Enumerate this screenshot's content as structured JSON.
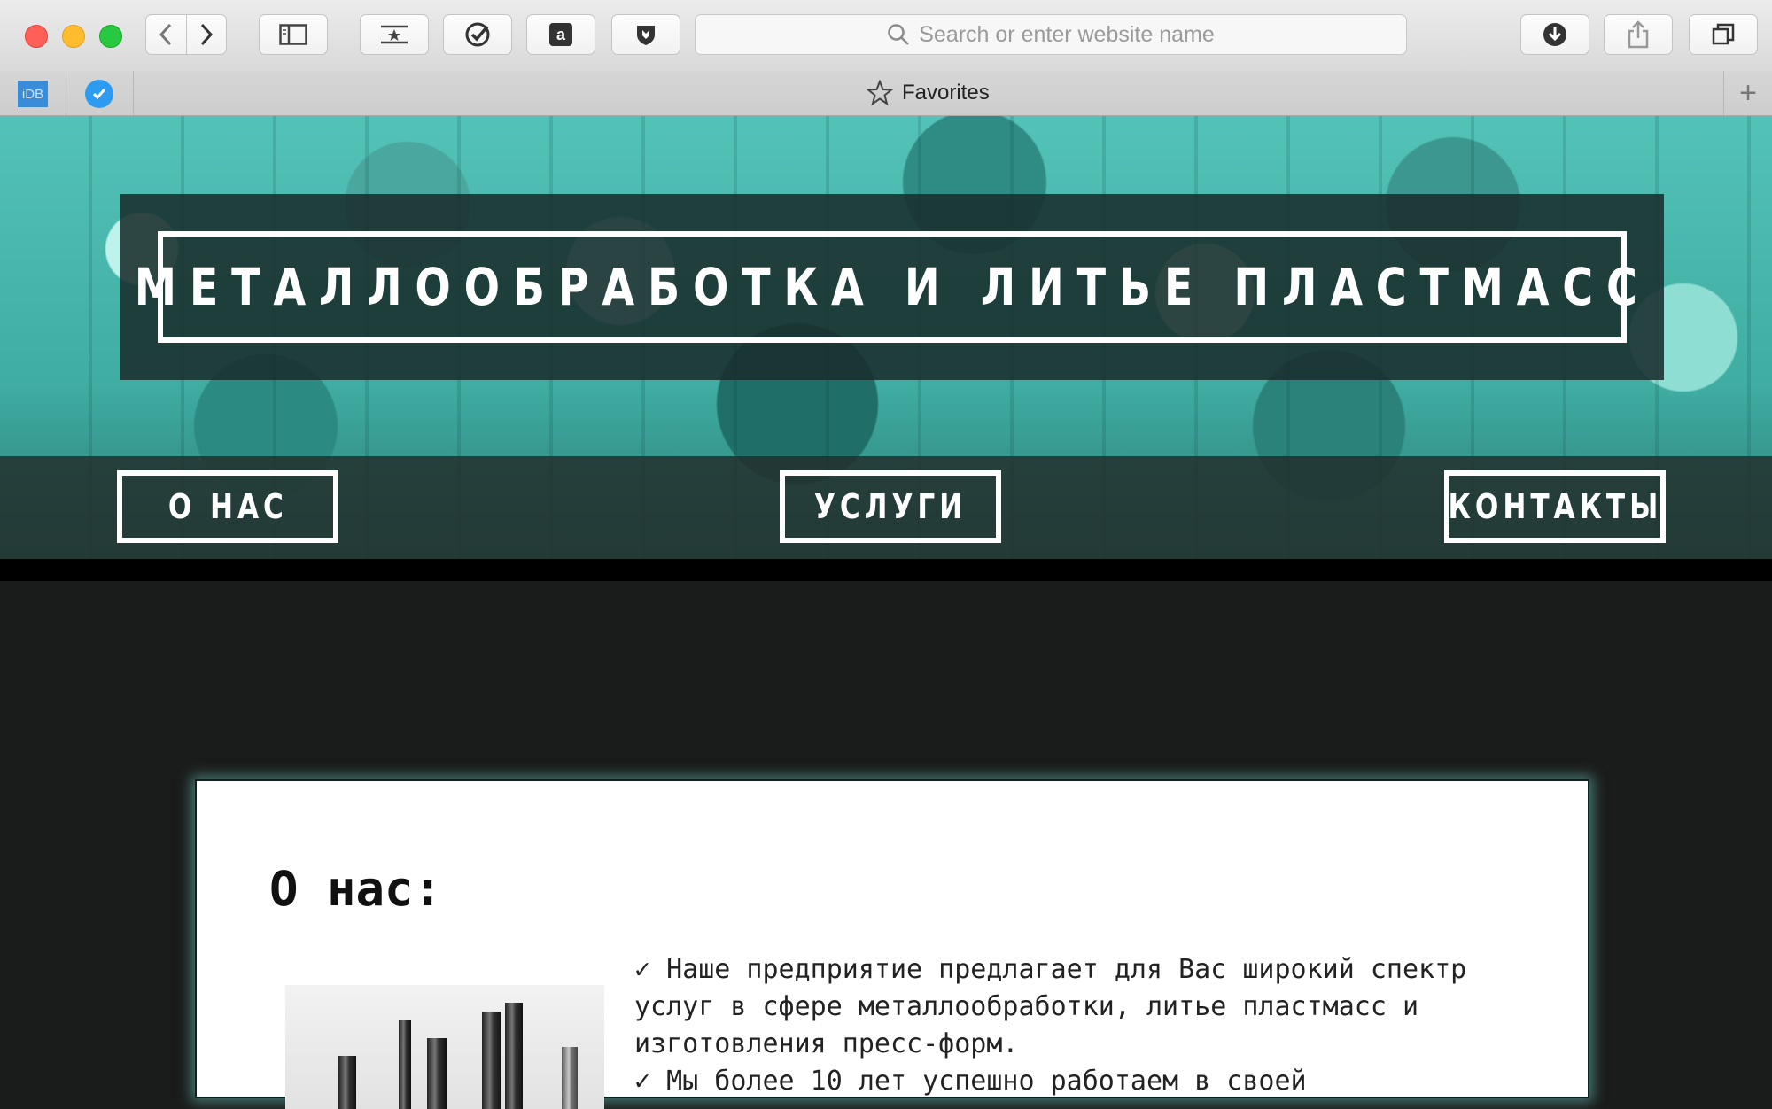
{
  "browser": {
    "address_placeholder": "Search or enter website name",
    "favorites_title": "Favorites",
    "fav_idb_label": "iDB"
  },
  "hero": {
    "title": "МЕТАЛЛООБРАБОТКА И ЛИТЬЕ ПЛАСТМАСС",
    "nav": {
      "about": "О НАС",
      "services": "УСЛУГИ",
      "contacts": "КОНТАКТЫ"
    }
  },
  "about": {
    "heading": "О нас:",
    "paragraphs": [
      "✓ Наше предприятие предлагает для Вас широкий спектр услуг в сфере металлообработки, литье пластмасс и изготовления пресс-форм.",
      "✓ Мы более 10 лет успешно работаем в своей"
    ]
  },
  "colors": {
    "hero_teal": "#48b8ad",
    "dark_band": "#1f2d2c",
    "page_bg": "#1a1c1b",
    "card_glow": "#6ec8be"
  }
}
